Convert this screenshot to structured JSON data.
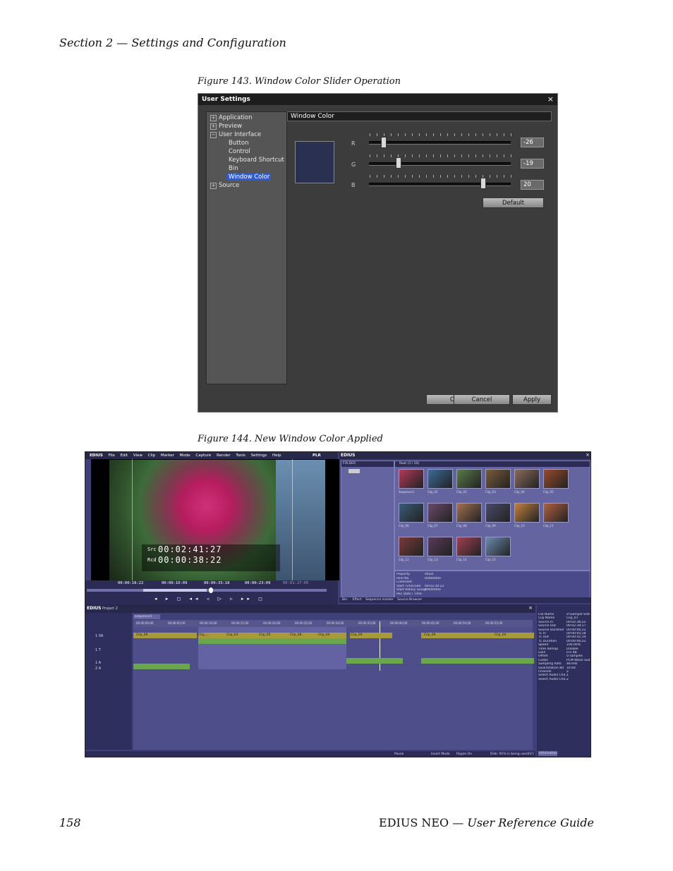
{
  "header": {
    "section": "Section 2 — Settings and Configuration"
  },
  "figure143": {
    "caption": "Figure 143.  Window Color Slider Operation",
    "dialog": {
      "title": "User Settings",
      "close": "×",
      "tree": {
        "application": "Application",
        "preview": "Preview",
        "user_interface": "User Interface",
        "button": "Button",
        "control": "Control",
        "keyboard_shortcut": "Keyboard Shortcut",
        "bin": "Bin",
        "window_color": "Window Color",
        "source": "Source"
      },
      "panel_title": "Window Color",
      "r_label": "R",
      "g_label": "G",
      "b_label": "B",
      "r_value": "-26",
      "g_value": "-19",
      "b_value": "20",
      "default_button": "Default",
      "ok_button": "OK",
      "cancel_button": "Cancel",
      "apply_button": "Apply",
      "swatch_color": "#2a3050"
    }
  },
  "figure144": {
    "caption": "Figure 144.  New Window Color Applied",
    "editor": {
      "app_name": "EDIUS",
      "menu": [
        "File",
        "Edit",
        "View",
        "Clip",
        "Marker",
        "Mode",
        "Capture",
        "Render",
        "Tools",
        "Settings",
        "Help"
      ],
      "plr": "PLR",
      "src_label": "Src",
      "src_tc": "00:02:41:27",
      "rcd_label": "Rcd",
      "rcd_tc": "00:00:38:22",
      "cur_tc": "00:00:18:22",
      "in_tc": "00:00:10:09",
      "out_tc": "00:00:33:18",
      "dur_tc": "00:00:23:09",
      "ttl_tc": "00:01:27:05",
      "bin_title": "EDIUS",
      "folder_label": "FOLDER",
      "root_label": "Root (3 / 10)",
      "clips": [
        "Sequence1",
        "Clip_01",
        "Clip_02",
        "Clip_03",
        "Clip_04",
        "Clip_05",
        "Clip_06",
        "Clip_07",
        "Clip_08",
        "Clip_09",
        "Clip_10",
        "Clip_11",
        "Clip_12",
        "Clip_13",
        "Clip_14",
        "Clip_15"
      ],
      "bin_tabs": [
        "Bin",
        "Effect",
        "Sequence marker",
        "Source Browser"
      ],
      "props": [
        [
          "Property",
          "Value"
        ],
        [
          "Reel No.",
          "00000000"
        ],
        [
          "Comment",
          ""
        ],
        [
          "Start Timecode",
          "00:02:30:22"
        ],
        [
          "Start Rotary Group",
          "00000000"
        ],
        [
          "Rec Date / Time",
          ""
        ]
      ],
      "project_label": "EDIUS",
      "project_name": "Project 2",
      "sequence_tab": "sequence1",
      "tracks": [
        "1 VA",
        "1 T",
        "1 A",
        "2 A"
      ],
      "ruler": [
        "00:00:00;00",
        "00:00:05;00",
        "00:00:10;00",
        "00:00:15;00",
        "00:00:20;00",
        "00:00:25;00",
        "00:00:30;00",
        "00:00:35;00",
        "00:00:40;00",
        "00:00:45;00",
        "00:00:50;00",
        "00:00:55;00"
      ],
      "track_clips": [
        "Clip_06",
        "Clip_...",
        "Clip_03",
        "Clip_05",
        "Clip_08",
        "Clip_04",
        "Clip_09",
        "Clip_06",
        "Clip_04"
      ],
      "info_rows": [
        [
          "File Name",
          "V:\\Sample Videos..."
        ],
        [
          "Clip Name",
          "Clip_07"
        ],
        [
          "Source In",
          "00:02:36;22"
        ],
        [
          "Source Out",
          "00:02:39;17"
        ],
        [
          "Source Duration",
          "00:00:06;22"
        ],
        [
          "TL In",
          "00:00:05;18"
        ],
        [
          "TL Out",
          "00:00:41;14"
        ],
        [
          "TL Duration",
          "00:00:06;22"
        ],
        [
          "Speed",
          "100.00%"
        ],
        [
          "Time Remap",
          "Disable"
        ],
        [
          "Gain",
          "0.0 dB"
        ],
        [
          "Offset",
          "0 samples"
        ],
        [
          "Codec",
          "PCM Wave audio"
        ],
        [
          "Sampling Rate",
          "48 kHz"
        ],
        [
          "Quantization Bit",
          "16 bit"
        ],
        [
          "Channel",
          "2"
        ],
        [
          "Select Audio Cha...",
          "1"
        ],
        [
          "Select Audio Cha...",
          "2"
        ]
      ],
      "info_tab": "Information",
      "status": [
        "Pause",
        "Insert Mode",
        "Ripple On",
        "Disk: 91% is being used(V:)"
      ],
      "ui_color": "#3f3f79"
    }
  },
  "footer": {
    "page": "158",
    "guide_product": "EDIUS NEO",
    "guide_sep": " — ",
    "guide_title": "User Reference Guide"
  }
}
